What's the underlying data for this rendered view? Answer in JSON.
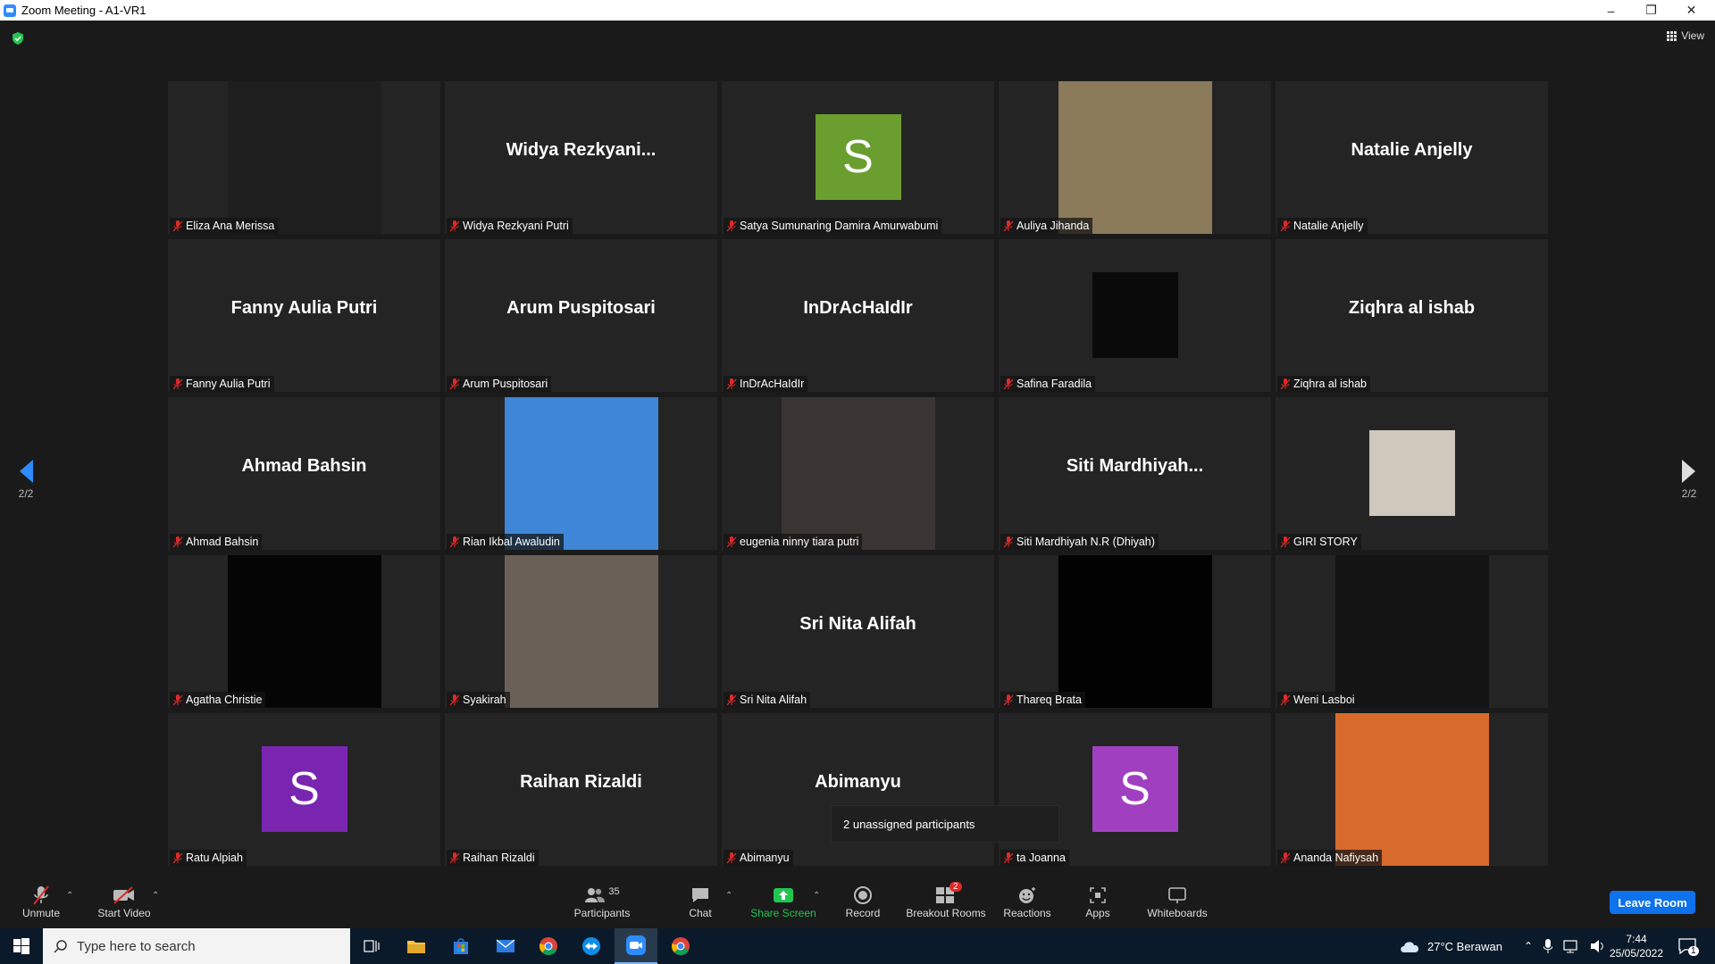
{
  "window": {
    "title": "Zoom Meeting - A1-VR1"
  },
  "top": {
    "view_label": "View"
  },
  "nav": {
    "page_left": "2/2",
    "page_right": "2/2"
  },
  "tiles": [
    {
      "display": "photo",
      "name": "Eliza Ana Merissa",
      "bg": "#1e1e1e"
    },
    {
      "display": "name",
      "big": "Widya  Rezkyani...",
      "name": "Widya Rezkyani Putri"
    },
    {
      "display": "avatar",
      "letter": "S",
      "avatar_color": "#6a9f2f",
      "name": "Satya Sumunaring Damira Amurwabumi"
    },
    {
      "display": "photo",
      "name": "Auliya Jihanda",
      "bg": "#8a7a5a"
    },
    {
      "display": "name",
      "big": "Natalie Anjelly",
      "name": "Natalie Anjelly"
    },
    {
      "display": "name",
      "big": "Fanny Aulia Putri",
      "name": "Fanny Aulia Putri"
    },
    {
      "display": "name",
      "big": "Arum Puspitosari",
      "name": "Arum Puspitosari"
    },
    {
      "display": "name",
      "big": "InDrAcHaIdIr",
      "name": "InDrAcHaIdIr"
    },
    {
      "display": "photo-small",
      "name": "Safina Faradila",
      "bg": "#0a0a0a"
    },
    {
      "display": "name",
      "big": "Ziqhra al ishab",
      "name": "Ziqhra al ishab"
    },
    {
      "display": "name",
      "big": "Ahmad Bahsin",
      "name": "Ahmad Bahsin"
    },
    {
      "display": "photo",
      "name": "Rian Ikbal Awaludin",
      "bg": "#3f86d6"
    },
    {
      "display": "photo",
      "name": "eugenia ninny tiara putri",
      "bg": "#3a3432"
    },
    {
      "display": "name",
      "big": "Siti  Mardhiyah...",
      "name": "Siti Mardhiyah N.R (Dhiyah)"
    },
    {
      "display": "photo-small",
      "name": "GIRI STORY",
      "bg": "#cfc8bc"
    },
    {
      "display": "photo",
      "name": "Agatha Christie",
      "bg": "#050505"
    },
    {
      "display": "photo",
      "name": "Syakirah",
      "bg": "#6b6058"
    },
    {
      "display": "name",
      "big": "Sri Nita Alifah",
      "name": "Sri Nita Alifah"
    },
    {
      "display": "photo",
      "name": "Thareq Brata",
      "bg": "#020202"
    },
    {
      "display": "photo",
      "name": "Weni Lasboi",
      "bg": "#141414"
    },
    {
      "display": "avatar",
      "letter": "S",
      "avatar_color": "#7a25b0",
      "name": "Ratu Alpiah"
    },
    {
      "display": "name",
      "big": "Raihan Rizaldi",
      "name": "Raihan Rizaldi"
    },
    {
      "display": "name",
      "big": "Abimanyu",
      "name": "Abimanyu"
    },
    {
      "display": "avatar",
      "letter": "S",
      "avatar_color": "#a040c0",
      "name": "ta Joanna"
    },
    {
      "display": "photo",
      "name": "Ananda Nafiysah",
      "bg": "#d86a2c"
    }
  ],
  "tooltip": {
    "text": "2 unassigned participants"
  },
  "toolbar": {
    "unmute": "Unmute",
    "start_video": "Start Video",
    "participants": "Participants",
    "participants_count": "35",
    "chat": "Chat",
    "share_screen": "Share Screen",
    "record": "Record",
    "breakout_rooms": "Breakout Rooms",
    "breakout_badge": "2",
    "reactions": "Reactions",
    "apps": "Apps",
    "whiteboards": "Whiteboards",
    "leave_room": "Leave Room"
  },
  "taskbar": {
    "search_placeholder": "Type here to search",
    "weather": "27°C  Berawan",
    "time": "7:44",
    "date": "25/05/2022",
    "notification_count": "1"
  },
  "colors": {
    "accent": "#0e72ed",
    "share_green": "#23c552",
    "badge_red": "#e02828"
  }
}
